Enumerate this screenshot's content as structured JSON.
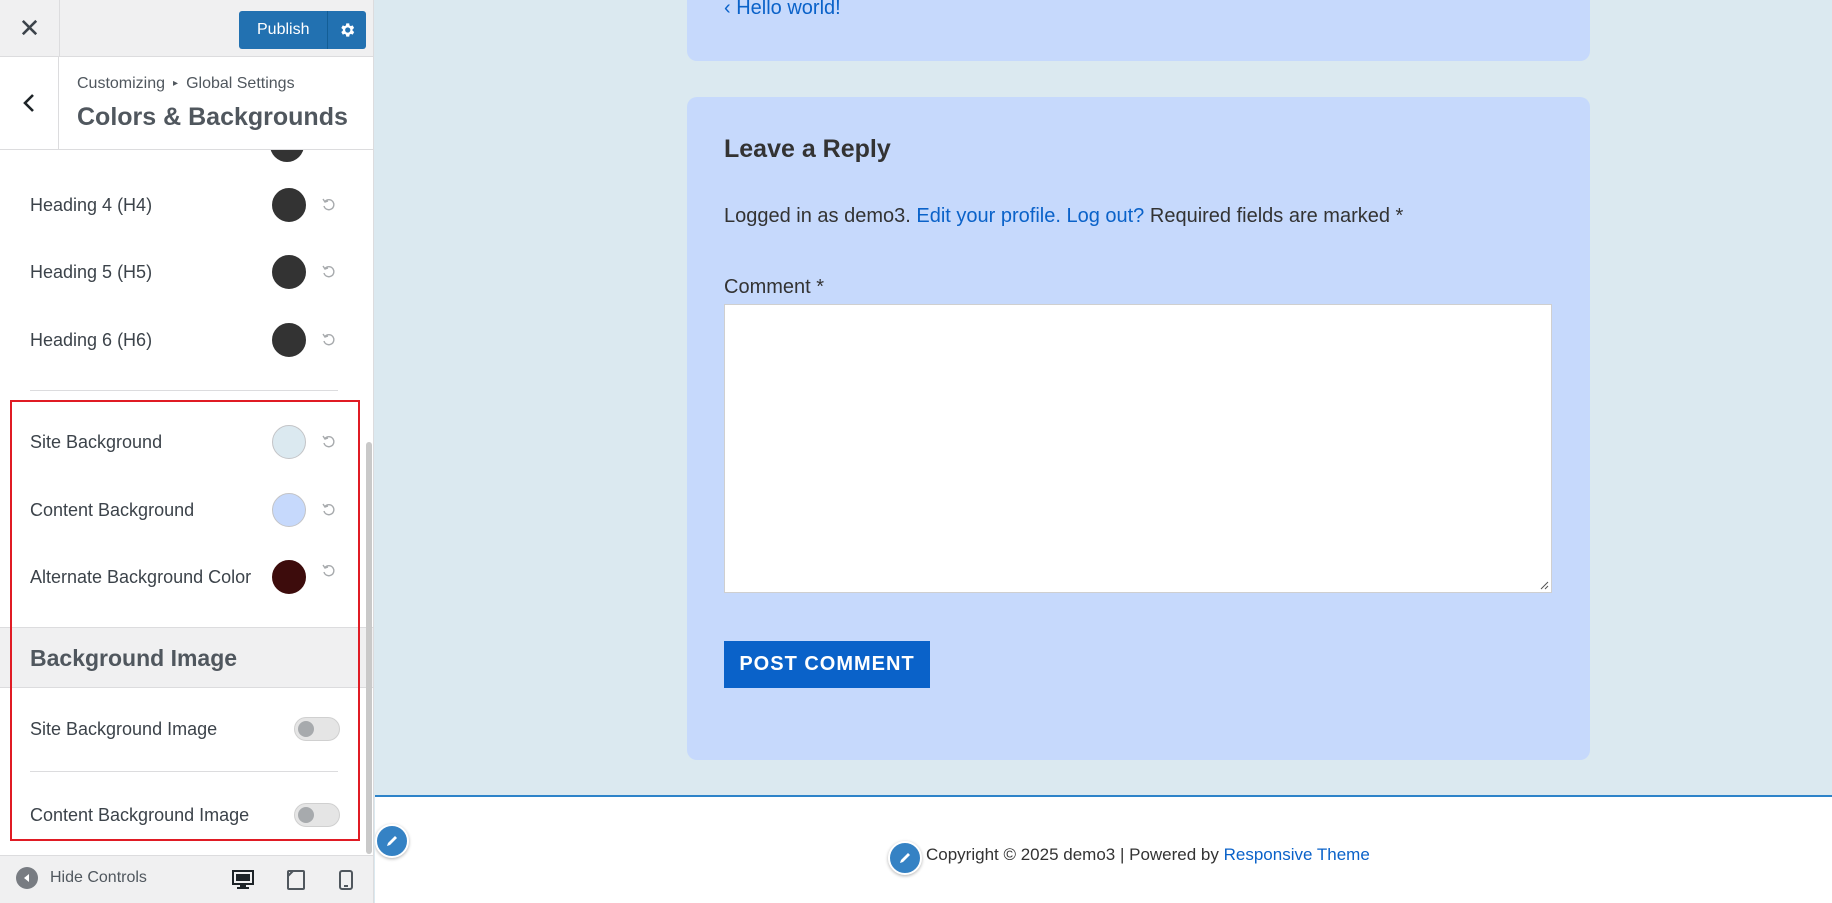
{
  "topbar": {
    "publish_label": "Publish"
  },
  "header": {
    "breadcrumb_root": "Customizing",
    "breadcrumb_sep": "▸",
    "breadcrumb_parent": "Global Settings",
    "title": "Colors & Backgrounds"
  },
  "colors": [
    {
      "label": "Heading 4 (H4)",
      "color": "#333333"
    },
    {
      "label": "Heading 5 (H5)",
      "color": "#333333"
    },
    {
      "label": "Heading 6 (H6)",
      "color": "#333333"
    },
    {
      "label": "Site Background",
      "color": "#dbe9f0"
    },
    {
      "label": "Content Background",
      "color": "#c6d9fc"
    },
    {
      "label": "Alternate Background Color",
      "color": "#3d0c0c"
    }
  ],
  "background_image": {
    "heading": "Background Image",
    "toggles": [
      {
        "label": "Site Background Image",
        "on": false
      },
      {
        "label": "Content Background Image",
        "on": false
      }
    ]
  },
  "footerbar": {
    "hide_controls": "Hide Controls"
  },
  "preview": {
    "prev_link": "‹ Hello world!",
    "reply_title": "Leave a Reply",
    "logged_in_prefix": "Logged in as demo3.",
    "edit_profile": "Edit your profile.",
    "log_out": "Log out?",
    "required_note": "Required fields are marked *",
    "comment_label": "Comment *",
    "post_button": "POST COMMENT",
    "copyright": "Copyright © 2025 demo3 | Powered by",
    "theme_link": "Responsive Theme"
  },
  "accent_colors": {
    "primary": "#2271b1",
    "link": "#0a62c9",
    "highlight": "#e01b24"
  }
}
